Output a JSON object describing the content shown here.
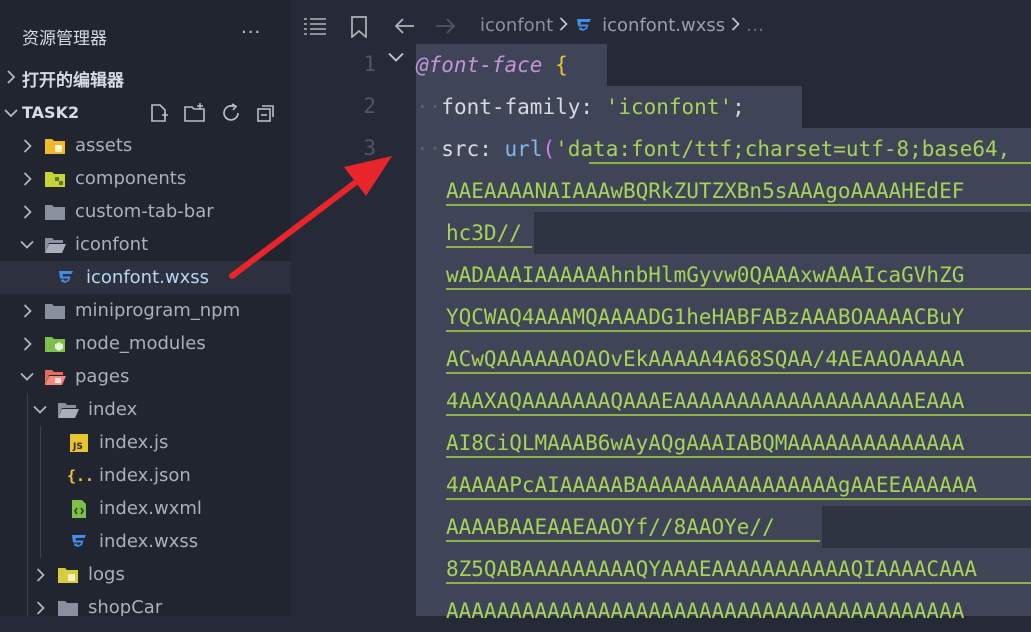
{
  "sidebar": {
    "title": "资源管理器",
    "more": "···",
    "open_editors": {
      "label": "打开的编辑器"
    },
    "project": {
      "label": "TASK2"
    },
    "tree": [
      {
        "name": "assets",
        "icon": "folder-assets-icon",
        "depth": 0,
        "expanded": false
      },
      {
        "name": "components",
        "icon": "folder-components-icon",
        "depth": 0,
        "expanded": false
      },
      {
        "name": "custom-tab-bar",
        "icon": "folder-icon",
        "depth": 0,
        "expanded": false
      },
      {
        "name": "iconfont",
        "icon": "folder-open-icon",
        "depth": 0,
        "expanded": true
      },
      {
        "name": "iconfont.wxss",
        "icon": "css-file-icon",
        "depth": 1,
        "selected": true
      },
      {
        "name": "miniprogram_npm",
        "icon": "folder-icon",
        "depth": 0,
        "expanded": false
      },
      {
        "name": "node_modules",
        "icon": "folder-node-icon",
        "depth": 0,
        "expanded": false
      },
      {
        "name": "pages",
        "icon": "folder-pages-icon",
        "depth": 0,
        "expanded": true
      },
      {
        "name": "index",
        "icon": "folder-open-icon",
        "depth": 1,
        "expanded": true
      },
      {
        "name": "index.js",
        "icon": "js-file-icon",
        "depth": 2
      },
      {
        "name": "index.json",
        "icon": "json-file-icon",
        "depth": 2
      },
      {
        "name": "index.wxml",
        "icon": "wxml-file-icon",
        "depth": 2
      },
      {
        "name": "index.wxss",
        "icon": "css-file-icon",
        "depth": 2
      },
      {
        "name": "logs",
        "icon": "folder-logs-icon",
        "depth": 1,
        "expanded": false
      },
      {
        "name": "shopCar",
        "icon": "folder-icon",
        "depth": 1,
        "expanded": false
      }
    ]
  },
  "editor": {
    "breadcrumb": [
      "iconfont",
      "iconfont.wxss"
    ],
    "line_numbers": [
      "1",
      "2",
      "3"
    ],
    "code": {
      "line1_at": "@font-face",
      "line1_brace": "{",
      "line2_prop": "font-family:",
      "line2_value": "'iconfont'",
      "line2_end": ";",
      "line3_prop": "src:",
      "line3_func": "url",
      "line3_paren": "(",
      "line3_value": "'data:font/ttf;charset=utf-8;base64,",
      "wrapped": [
        "AAEAAAANAIAAAwBQRkZUTZXBn5sAAAgoAAAAHEdEF",
        "hc3D//",
        "wADAAAIAAAAAAhnbHlmGyvw0QAAAxwAAAIcaGVhZG",
        "YQCWAQ4AAAMQAAAADG1heHABFABzAAABOAAAACBuY",
        "ACwQAAAAAAOAOvEkAAAAA4A68SQAA/4AEAAOAAAAA",
        "4AAXAQAAAAAAAQAAAEAAAAAAAAAAAAAAAAAAAEAAA",
        "AI8CiQLMAAAB6wAyAQgAAAIABQMAAAAAAAAAAAAAA",
        "4AAAAPcAIAAAAABAAAAAAAAAAAAAAAAgAAEEAAAAAA",
        "AAAABAAEAAEAAOYf//8AAOYe//",
        "8Z5QABAAAAAAAAAQYAAAEAAAAAAAAAAAQIAAAACAAA",
        "AAAAAAAAAAAAAAAAAAAAAAAAAAAAAAAAAAAAAAAAA"
      ]
    }
  },
  "annotation": {
    "arrow_color": "#e8252a"
  }
}
